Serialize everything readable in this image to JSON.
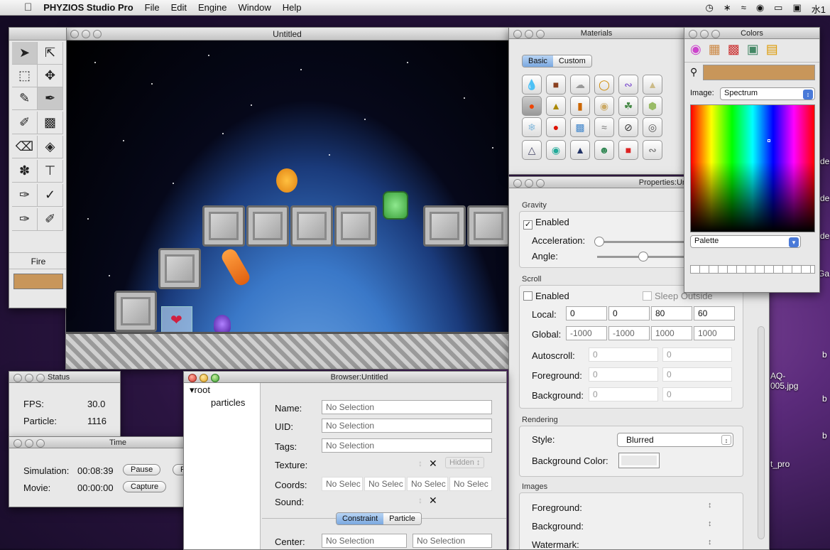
{
  "menubar": {
    "app": "PHYZIOS Studio Pro",
    "items": [
      "File",
      "Edit",
      "Engine",
      "Window",
      "Help"
    ],
    "clock": "水1"
  },
  "toolbox": {
    "material_label": "Fire",
    "swatch": "#c8965a"
  },
  "main_window": {
    "title": "Untitled"
  },
  "materials": {
    "title": "Materials",
    "tabs": [
      "Basic",
      "Custom"
    ]
  },
  "colors": {
    "title": "Colors",
    "image_label": "Image:",
    "image_value": "Spectrum",
    "palette_value": "Palette",
    "swatch": "#c8965a"
  },
  "properties": {
    "title": "Properties:Untitled",
    "gravity": {
      "section": "Gravity",
      "enabled": "Enabled",
      "acceleration": "Acceleration:",
      "angle": "Angle:"
    },
    "scroll": {
      "section": "Scroll",
      "enabled": "Enabled",
      "sleep": "Sleep Outside",
      "local_label": "Local:",
      "local": [
        "0",
        "0",
        "80",
        "60"
      ],
      "global_label": "Global:",
      "global": [
        "-1000",
        "-1000",
        "1000",
        "1000"
      ],
      "autoscroll_label": "Autoscroll:",
      "autoscroll": [
        "0",
        "0"
      ],
      "foreground_label": "Foreground:",
      "foreground": [
        "0",
        "0"
      ],
      "background_label": "Background:",
      "background": [
        "0",
        "0"
      ]
    },
    "rendering": {
      "section": "Rendering",
      "style_label": "Style:",
      "style": "Blurred",
      "bgcolor_label": "Background Color:"
    },
    "images": {
      "section": "Images",
      "foreground": "Foreground:",
      "background": "Background:",
      "watermark": "Watermark:"
    }
  },
  "status": {
    "title": "Status",
    "fps_label": "FPS:",
    "fps": "30.0",
    "particle_label": "Particle:",
    "particle": "1116"
  },
  "time": {
    "title": "Time",
    "sim_label": "Simulation:",
    "sim": "00:08:39",
    "pause": "Pause",
    "reset": "Reset",
    "movie_label": "Movie:",
    "movie": "00:00:00",
    "capture": "Capture"
  },
  "browser": {
    "title": "Browser:Untitled",
    "tree": [
      "root",
      "particles"
    ],
    "name_label": "Name:",
    "uid_label": "UID:",
    "tags_label": "Tags:",
    "texture_label": "Texture:",
    "coords_label": "Coords:",
    "sound_label": "Sound:",
    "no_selection": "No Selection",
    "hidden": "Hidden",
    "coords": [
      "No Selec",
      "No Selec",
      "No Selec",
      "No Selec"
    ],
    "tabs": [
      "Constraint",
      "Particle"
    ],
    "center_label": "Center:"
  },
  "desktop": {
    "files": [
      "AQ-\n005.jpg",
      "t_pro"
    ],
    "edge": [
      "de",
      "de",
      "de",
      "Ga",
      "b",
      "b",
      "b"
    ]
  }
}
